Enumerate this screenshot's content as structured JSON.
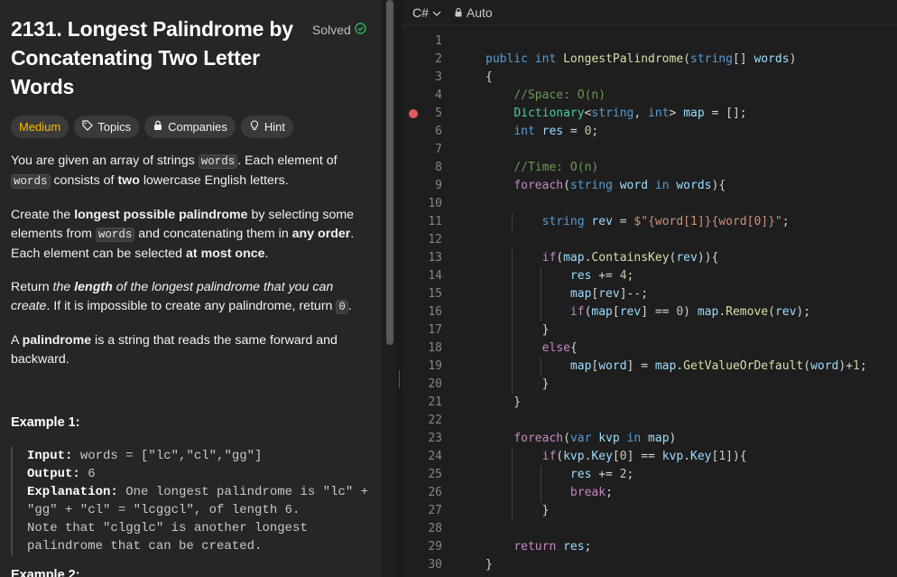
{
  "problem": {
    "title": "2131. Longest Palindrome by Concatenating Two Letter Words",
    "status": "Solved",
    "tags": {
      "difficulty": "Medium",
      "topics": "Topics",
      "companies": "Companies",
      "hint": "Hint"
    },
    "desc": {
      "p1a": "You are given an array of strings ",
      "p1code1": "words",
      "p1b": ". Each element of ",
      "p1code2": "words",
      "p1c": " consists of ",
      "p1bold": "two",
      "p1d": " lowercase English letters.",
      "p2a": "Create the ",
      "p2bold1": "longest possible palindrome",
      "p2b": " by selecting some elements from ",
      "p2code": "words",
      "p2c": " and concatenating them in ",
      "p2bold2": "any order",
      "p2d": ". Each element can be selected ",
      "p2bold3": "at most once",
      "p2e": ".",
      "p3a": "Return ",
      "p3i1": "the ",
      "p3ib": "length",
      "p3i2": " of the longest palindrome that you can create",
      "p3b": ". If it is impossible to create any palindrome, return ",
      "p3code": "0",
      "p3c": ".",
      "p4a": "A ",
      "p4bold": "palindrome",
      "p4b": " is a string that reads the same forward and backward."
    },
    "example1": {
      "heading": "Example 1:",
      "input_label": "Input:",
      "input_value": " words = [\"lc\",\"cl\",\"gg\"]",
      "output_label": "Output:",
      "output_value": " 6",
      "explanation_label": "Explanation:",
      "explanation_value": " One longest palindrome is \"lc\" + \"gg\" + \"cl\" = \"lcggcl\", of length 6.",
      "note": "Note that \"clgglc\" is another longest palindrome that can be created."
    },
    "example2_heading": "Example 2:"
  },
  "editor": {
    "language": "C#",
    "mode": "Auto",
    "breakpoint_line": 5,
    "line_numbers": [
      "1",
      "2",
      "3",
      "4",
      "5",
      "6",
      "7",
      "8",
      "9",
      "10",
      "11",
      "12",
      "13",
      "14",
      "15",
      "16",
      "17",
      "18",
      "19",
      "20",
      "21",
      "22",
      "23",
      "24",
      "25",
      "26",
      "27",
      "28",
      "29",
      "30"
    ],
    "code_lines": [
      "",
      "public int LongestPalindrome(string[] words)",
      "{",
      "    //Space: O(n)",
      "    Dictionary<string, int> map = [];",
      "    int res = 0;",
      "",
      "    //Time: O(n)",
      "    foreach(string word in words){",
      "",
      "        string rev = $\"{word[1]}{word[0]}\";",
      "",
      "        if(map.ContainsKey(rev)){",
      "            res += 4;",
      "            map[rev]--;",
      "            if(map[rev] == 0) map.Remove(rev);",
      "        }",
      "        else{",
      "            map[word] = map.GetValueOrDefault(word)+1;",
      "        }",
      "    }",
      "",
      "    foreach(var kvp in map)",
      "        if(kvp.Key[0] == kvp.Key[1]){",
      "            res += 2;",
      "            break;",
      "        }",
      "",
      "    return res;",
      "}"
    ]
  }
}
